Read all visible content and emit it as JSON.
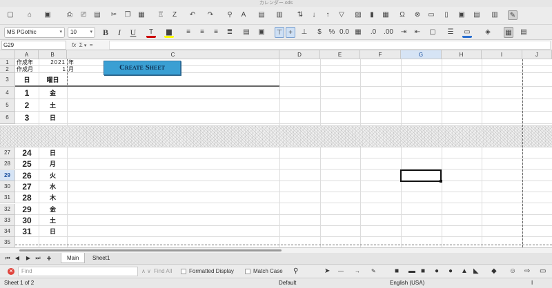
{
  "window": {
    "title": "カレンダー.ods"
  },
  "toolbar": {
    "font_name": "MS PGothic",
    "font_size": "10"
  },
  "formula_bar": {
    "name_box": "G29",
    "fx_label": "fx",
    "sum_label": "Σ",
    "eq_label": "="
  },
  "columns": [
    "A",
    "B",
    "C",
    "D",
    "E",
    "F",
    "G",
    "H",
    "I",
    "J"
  ],
  "selected_column": "G",
  "cells": {
    "a1": "作成年",
    "b1": "2021",
    "c1": "年",
    "a2": "作成月",
    "b2": "1",
    "c2": "月",
    "a3": "日",
    "b3": "曜日"
  },
  "create_button": "Create Sheet",
  "top_rows": [
    {
      "row": "1"
    },
    {
      "row": "2"
    },
    {
      "row": "3"
    },
    {
      "row": "4",
      "day": "1",
      "weekday": "金"
    },
    {
      "row": "5",
      "day": "2",
      "weekday": "土"
    },
    {
      "row": "6",
      "day": "3",
      "weekday": "日"
    }
  ],
  "bottom_rows": [
    {
      "row": "27",
      "day": "24",
      "weekday": "日"
    },
    {
      "row": "28",
      "day": "25",
      "weekday": "月"
    },
    {
      "row": "29",
      "day": "26",
      "weekday": "火"
    },
    {
      "row": "30",
      "day": "27",
      "weekday": "水"
    },
    {
      "row": "31",
      "day": "28",
      "weekday": "木"
    },
    {
      "row": "32",
      "day": "29",
      "weekday": "金"
    },
    {
      "row": "33",
      "day": "30",
      "weekday": "土"
    },
    {
      "row": "34",
      "day": "31",
      "weekday": "日"
    },
    {
      "row": "35"
    }
  ],
  "selected_row": "29",
  "sheet_tabs": [
    "Main",
    "Sheet1"
  ],
  "active_tab": "Main",
  "find_bar": {
    "placeholder": "Find",
    "find_all": "Find All",
    "formatted_display": "Formatted Display",
    "match_case": "Match Case"
  },
  "status_bar": {
    "sheet": "Sheet 1 of 2",
    "style": "Default",
    "language": "English (USA)"
  }
}
